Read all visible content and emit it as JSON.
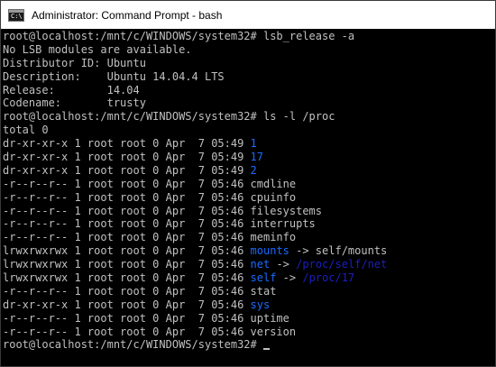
{
  "window": {
    "title": "Administrator: Command Prompt - bash",
    "icon": "cmd-icon",
    "icon_glyph": "C:\\"
  },
  "terminal": {
    "text_color": "#c0c0c0",
    "link_color": "#1a6bff",
    "target_color": "#1b1fc0",
    "lines": [
      [
        {
          "t": "root@localhost:/mnt/c/WINDOWS/system32# lsb_release -a",
          "c": "plain"
        }
      ],
      [
        {
          "t": "No LSB modules are available.",
          "c": "plain"
        }
      ],
      [
        {
          "t": "Distributor ID: Ubuntu",
          "c": "plain"
        }
      ],
      [
        {
          "t": "Description:    Ubuntu 14.04.4 LTS",
          "c": "plain"
        }
      ],
      [
        {
          "t": "Release:        14.04",
          "c": "plain"
        }
      ],
      [
        {
          "t": "Codename:       trusty",
          "c": "plain"
        }
      ],
      [
        {
          "t": "root@localhost:/mnt/c/WINDOWS/system32# ls -l /proc",
          "c": "plain"
        }
      ],
      [
        {
          "t": "total 0",
          "c": "plain"
        }
      ],
      [
        {
          "t": "dr-xr-xr-x 1 root root 0 Apr  7 05:49 ",
          "c": "plain"
        },
        {
          "t": "1",
          "c": "blue"
        }
      ],
      [
        {
          "t": "dr-xr-xr-x 1 root root 0 Apr  7 05:49 ",
          "c": "plain"
        },
        {
          "t": "17",
          "c": "blue"
        }
      ],
      [
        {
          "t": "dr-xr-xr-x 1 root root 0 Apr  7 05:49 ",
          "c": "plain"
        },
        {
          "t": "2",
          "c": "blue"
        }
      ],
      [
        {
          "t": "-r--r--r-- 1 root root 0 Apr  7 05:46 cmdline",
          "c": "plain"
        }
      ],
      [
        {
          "t": "-r--r--r-- 1 root root 0 Apr  7 05:46 cpuinfo",
          "c": "plain"
        }
      ],
      [
        {
          "t": "-r--r--r-- 1 root root 0 Apr  7 05:46 filesystems",
          "c": "plain"
        }
      ],
      [
        {
          "t": "-r--r--r-- 1 root root 0 Apr  7 05:46 interrupts",
          "c": "plain"
        }
      ],
      [
        {
          "t": "-r--r--r-- 1 root root 0 Apr  7 05:46 meminfo",
          "c": "plain"
        }
      ],
      [
        {
          "t": "lrwxrwxrwx 1 root root 0 Apr  7 05:46 ",
          "c": "plain"
        },
        {
          "t": "mounts",
          "c": "blue"
        },
        {
          "t": " -> self/mounts",
          "c": "plain"
        }
      ],
      [
        {
          "t": "lrwxrwxrwx 1 root root 0 Apr  7 05:46 ",
          "c": "plain"
        },
        {
          "t": "net",
          "c": "blue"
        },
        {
          "t": " -> ",
          "c": "plain"
        },
        {
          "t": "/proc/self/net",
          "c": "dim"
        }
      ],
      [
        {
          "t": "lrwxrwxrwx 1 root root 0 Apr  7 05:46 ",
          "c": "plain"
        },
        {
          "t": "self",
          "c": "blue"
        },
        {
          "t": " -> ",
          "c": "plain"
        },
        {
          "t": "/proc/17",
          "c": "dim"
        }
      ],
      [
        {
          "t": "-r--r--r-- 1 root root 0 Apr  7 05:46 stat",
          "c": "plain"
        }
      ],
      [
        {
          "t": "dr-xr-xr-x 1 root root 0 Apr  7 05:46 ",
          "c": "plain"
        },
        {
          "t": "sys",
          "c": "blue"
        }
      ],
      [
        {
          "t": "-r--r--r-- 1 root root 0 Apr  7 05:46 uptime",
          "c": "plain"
        }
      ],
      [
        {
          "t": "-r--r--r-- 1 root root 0 Apr  7 05:46 version",
          "c": "plain"
        }
      ],
      [
        {
          "t": "root@localhost:/mnt/c/WINDOWS/system32# ",
          "c": "plain"
        }
      ]
    ]
  }
}
